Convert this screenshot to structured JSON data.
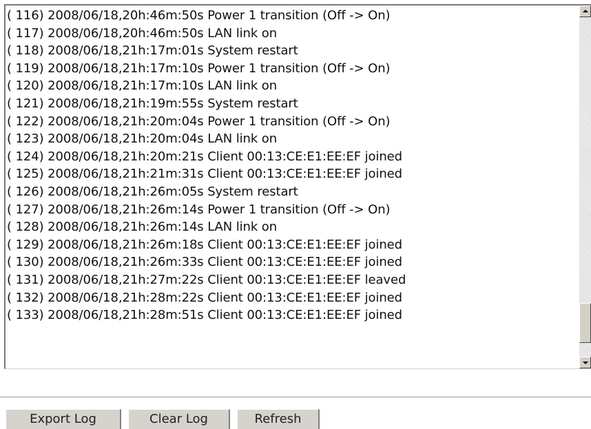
{
  "log": {
    "lines": [
      "( 116) 2008/06/18,20h:46m:50s Power 1 transition (Off -> On)",
      "( 117) 2008/06/18,20h:46m:50s LAN link on",
      "( 118) 2008/06/18,21h:17m:01s System restart",
      "( 119) 2008/06/18,21h:17m:10s Power 1 transition (Off -> On)",
      "( 120) 2008/06/18,21h:17m:10s LAN link on",
      "( 121) 2008/06/18,21h:19m:55s System restart",
      "( 122) 2008/06/18,21h:20m:04s Power 1 transition (Off -> On)",
      "( 123) 2008/06/18,21h:20m:04s LAN link on",
      "( 124) 2008/06/18,21h:20m:21s Client 00:13:CE:E1:EE:EF joined",
      "( 125) 2008/06/18,21h:21m:31s Client 00:13:CE:E1:EE:EF joined",
      "( 126) 2008/06/18,21h:26m:05s System restart",
      "( 127) 2008/06/18,21h:26m:14s Power 1 transition (Off -> On)",
      "( 128) 2008/06/18,21h:26m:14s LAN link on",
      "( 129) 2008/06/18,21h:26m:18s Client 00:13:CE:E1:EE:EF joined",
      "( 130) 2008/06/18,21h:26m:33s Client 00:13:CE:E1:EE:EF joined",
      "( 131) 2008/06/18,21h:27m:22s Client 00:13:CE:E1:EE:EF leaved",
      "( 132) 2008/06/18,21h:28m:22s Client 00:13:CE:E1:EE:EF joined",
      "( 133) 2008/06/18,21h:28m:51s Client 00:13:CE:E1:EE:EF joined"
    ],
    "scroll_position": 0.95
  },
  "scrollbar": {
    "up_icon": "arrow-up-icon",
    "down_icon": "arrow-down-icon"
  },
  "buttons": {
    "export_label": "Export Log",
    "clear_label": "Clear Log",
    "refresh_label": "Refresh"
  },
  "colors": {
    "button_face": "#d6d3ce",
    "text": "#111111",
    "background": "#ffffff"
  }
}
